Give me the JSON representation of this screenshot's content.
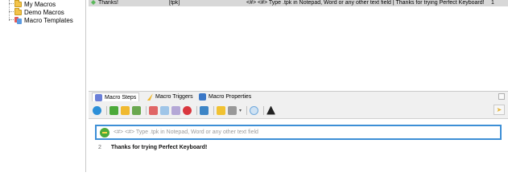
{
  "tree": {
    "items": [
      {
        "label": "My Macros",
        "icon": "folder-icon"
      },
      {
        "label": "Demo Macros",
        "icon": "folder-icon"
      },
      {
        "label": "Macro Templates",
        "icon": "templates-icon"
      }
    ]
  },
  "macro_list": {
    "selected_row": {
      "name": "Thanks!",
      "hotkey": "[tpk]",
      "content": "<#> <#> Type .tpk in Notepad, Word or any other text field | Thanks for trying Perfect Keyboard!",
      "count": "1"
    }
  },
  "bottom_panel": {
    "tabs": [
      {
        "label": "Macro Steps",
        "icon": "macro-steps-icon"
      },
      {
        "label": "Macro Triggers",
        "icon": "macro-triggers-icon"
      },
      {
        "label": "Macro Properties",
        "icon": "macro-properties-icon"
      }
    ],
    "steps": [
      {
        "number": "",
        "text": "<#> <#> Type .tpk in Notepad, Word or any other text field"
      },
      {
        "number": "2",
        "text": "Thanks for trying Perfect Keyboard!"
      }
    ]
  },
  "colors": {
    "selected_row": "#d8d8d8",
    "focus_border": "#3d8fd6",
    "folder": "#f3c34a"
  }
}
